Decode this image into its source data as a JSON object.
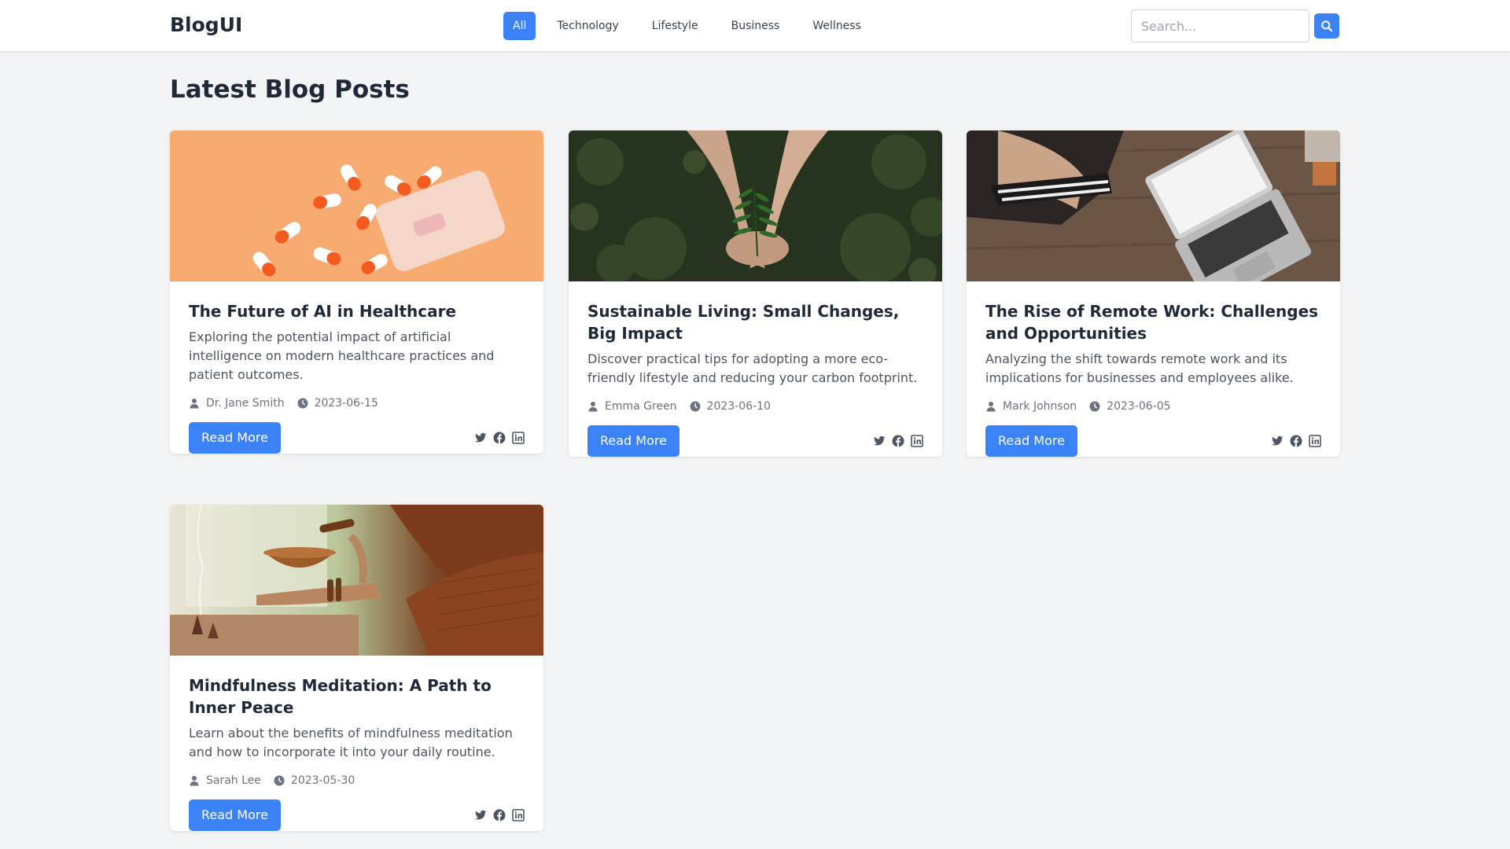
{
  "header": {
    "brand": "BlogUI",
    "nav": [
      "All",
      "Technology",
      "Lifestyle",
      "Business",
      "Wellness"
    ],
    "active_nav": "All",
    "search_placeholder": "Search..."
  },
  "main": {
    "title": "Latest Blog Posts",
    "read_more_label": "Read More",
    "posts": [
      {
        "title": "The Future of AI in Healthcare",
        "description": "Exploring the potential impact of artificial intelligence on modern healthcare practices and patient outcomes.",
        "author": "Dr. Jane Smith",
        "date": "2023-06-15",
        "image": "photo of orange and white capsule pills spilling from a bottle"
      },
      {
        "title": "Sustainable Living: Small Changes, Big Impact",
        "description": "Discover practical tips for adopting a more eco-friendly lifestyle and reducing your carbon footprint.",
        "author": "Emma Green",
        "date": "2023-06-10",
        "image": "photo of cupped hands holding a small fern plant"
      },
      {
        "title": "The Rise of Remote Work: Challenges and Opportunities",
        "description": "Analyzing the shift towards remote work and its implications for businesses and employees alike.",
        "author": "Mark Johnson",
        "date": "2023-06-05",
        "image": "photo of a person working on a laptop at a wooden desk"
      },
      {
        "title": "Mindfulness Meditation: A Path to Inner Peace",
        "description": "Learn about the benefits of mindfulness meditation and how to incorporate it into your daily routine.",
        "author": "Sarah Lee",
        "date": "2023-05-30",
        "image": "photo of a hand holding a copper singing bowl with incense"
      }
    ]
  },
  "icons": {
    "author": "user-icon",
    "date": "clock-icon",
    "share": [
      "twitter-icon",
      "facebook-icon",
      "linkedin-icon"
    ]
  },
  "colors": {
    "accent": "#3b82f6",
    "background": "#f3f4f6",
    "text": "#1f2937"
  }
}
